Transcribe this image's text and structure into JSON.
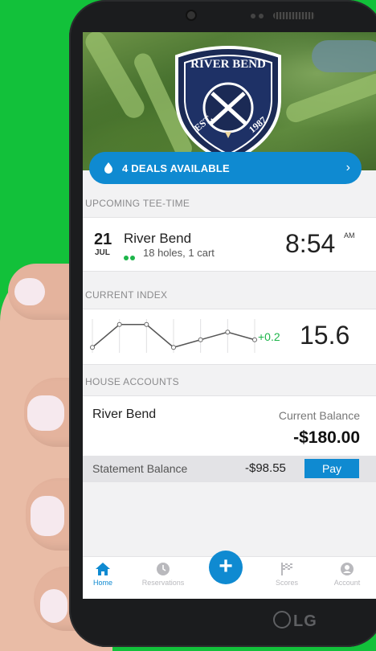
{
  "hero": {
    "crest_line1": "RIVER BEND",
    "crest_est": "EST.",
    "crest_year": "1987"
  },
  "deals": {
    "label": "4 DEALS AVAILABLE",
    "chevron": "›"
  },
  "upcoming": {
    "header": "UPCOMING TEE-TIME",
    "day": "21",
    "month": "JUL",
    "course": "River Bend",
    "details": "18 holes, 1 cart",
    "time": "8:54",
    "ampm": "AM"
  },
  "index": {
    "header": "CURRENT INDEX",
    "delta": "+0.2",
    "value": "15.6",
    "trend": [
      15.2,
      15.5,
      15.5,
      15.2,
      15.3,
      15.4,
      15.3
    ]
  },
  "house": {
    "header": "HOUSE ACCOUNTS",
    "account_name": "River Bend",
    "current_balance_label": "Current Balance",
    "current_balance": "-$180.00",
    "statement_label": "Statement Balance",
    "statement_balance": "-$98.55",
    "pay_label": "Pay"
  },
  "tabs": [
    {
      "label": "Home",
      "icon": "home-icon"
    },
    {
      "label": "Reservations",
      "icon": "clock-icon"
    },
    {
      "label": "+",
      "icon": "plus-icon"
    },
    {
      "label": "Scores",
      "icon": "flag-icon"
    },
    {
      "label": "Account",
      "icon": "person-icon"
    }
  ],
  "device": {
    "brand": "LG"
  },
  "colors": {
    "accent": "#0f8ad1",
    "positive": "#1db54a",
    "background": "#12c13a"
  }
}
